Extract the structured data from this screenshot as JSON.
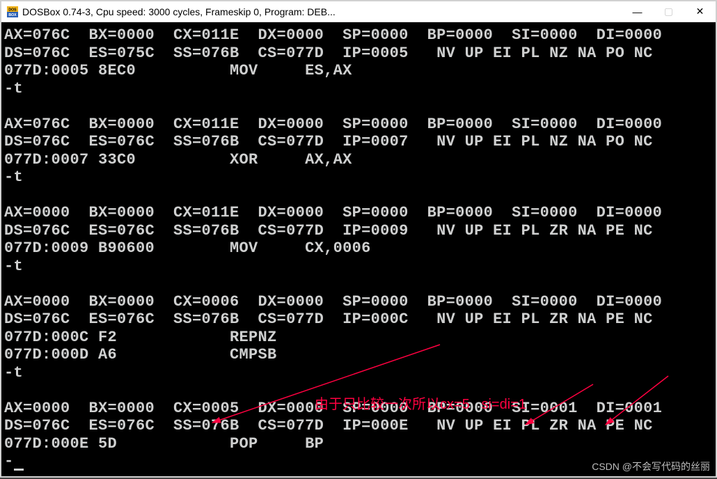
{
  "window": {
    "title": "DOSBox 0.74-3, Cpu speed:    3000 cycles, Frameskip  0, Program:    DEB...",
    "minimize": "—",
    "maximize": "▢",
    "close": "✕"
  },
  "icon_top": "DOS",
  "icon_bottom": "BOX",
  "terminal_lines": [
    "AX=076C  BX=0000  CX=011E  DX=0000  SP=0000  BP=0000  SI=0000  DI=0000",
    "DS=076C  ES=075C  SS=076B  CS=077D  IP=0005   NV UP EI PL NZ NA PO NC",
    "077D:0005 8EC0          MOV     ES,AX",
    "-t",
    "",
    "AX=076C  BX=0000  CX=011E  DX=0000  SP=0000  BP=0000  SI=0000  DI=0000",
    "DS=076C  ES=076C  SS=076B  CS=077D  IP=0007   NV UP EI PL NZ NA PO NC",
    "077D:0007 33C0          XOR     AX,AX",
    "-t",
    "",
    "AX=0000  BX=0000  CX=011E  DX=0000  SP=0000  BP=0000  SI=0000  DI=0000",
    "DS=076C  ES=076C  SS=076B  CS=077D  IP=0009   NV UP EI PL ZR NA PE NC",
    "077D:0009 B90600        MOV     CX,0006",
    "-t",
    "",
    "AX=0000  BX=0000  CX=0006  DX=0000  SP=0000  BP=0000  SI=0000  DI=0000",
    "DS=076C  ES=076C  SS=076B  CS=077D  IP=000C   NV UP EI PL ZR NA PE NC",
    "077D:000C F2            REPNZ",
    "077D:000D A6            CMPSB",
    "-t",
    "",
    "AX=0000  BX=0000  CX=0005  DX=0000  SP=0000  BP=0000  SI=0001  DI=0001",
    "DS=076C  ES=076C  SS=076B  CS=077D  IP=000E   NV UP EI PL ZR NA PE NC",
    "077D:000E 5D            POP     BP"
  ],
  "annotation_main": "由于只比较一次所以cx=5   si=di=1",
  "watermark": "CSDN @不会写代码的丝丽"
}
